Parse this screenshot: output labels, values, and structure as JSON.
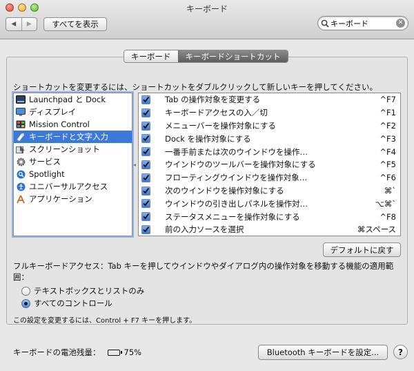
{
  "window": {
    "title": "キーボード"
  },
  "toolbar": {
    "back_glyph": "◀",
    "forward_glyph": "▶",
    "show_all_label": "すべてを表示",
    "search_value": "キーボード"
  },
  "tabs": [
    {
      "label": "キーボード",
      "active": false
    },
    {
      "label": "キーボードショートカット",
      "active": true
    }
  ],
  "instruction": "ショートカットを変更するには、ショートカットをダブルクリックして新しいキーを押してください。",
  "categories": [
    {
      "label": "Launchpad と Dock",
      "icon": "launchpad-dock-icon"
    },
    {
      "label": "ディスプレイ",
      "icon": "display-icon"
    },
    {
      "label": "Mission Control",
      "icon": "mission-control-icon"
    },
    {
      "label": "キーボードと文字入力",
      "icon": "keyboard-input-icon",
      "selected": true
    },
    {
      "label": "スクリーンショット",
      "icon": "screenshot-icon"
    },
    {
      "label": "サービス",
      "icon": "services-gear-icon"
    },
    {
      "label": "Spotlight",
      "icon": "spotlight-icon"
    },
    {
      "label": "ユニバーサルアクセス",
      "icon": "universal-access-icon"
    },
    {
      "label": "アプリケーション",
      "icon": "applications-icon"
    }
  ],
  "shortcuts": [
    {
      "name": "Tab の操作対象を変更する",
      "key": "^F7",
      "checked": true
    },
    {
      "name": "キーボードアクセスの入／切",
      "key": "^F1",
      "checked": true
    },
    {
      "name": "メニューバーを操作対象にする",
      "key": "^F2",
      "checked": true
    },
    {
      "name": "Dock を操作対象にする",
      "key": "^F3",
      "checked": true
    },
    {
      "name": "一番手前または次のウインドウを操作…",
      "key": "^F4",
      "checked": true
    },
    {
      "name": "ウインドウのツールバーを操作対象にする",
      "key": "^F5",
      "checked": true
    },
    {
      "name": "フローティングウインドウを操作対象…",
      "key": "^F6",
      "checked": true
    },
    {
      "name": "次のウインドウを操作対象にする",
      "key": "⌘`",
      "checked": true
    },
    {
      "name": "ウインドウの引き出しパネルを操作対…",
      "key": "⌥⌘`",
      "checked": true
    },
    {
      "name": "ステータスメニューを操作対象にする",
      "key": "^F8",
      "checked": true
    },
    {
      "name": "前の入力ソースを選択",
      "key": "⌘スペース",
      "checked": true
    }
  ],
  "default_button_label": "デフォルトに戻す",
  "full_keyboard_access": {
    "description": "フルキーボードアクセス：Tab キーを押してウインドウやダイアログ内の操作対象を移動する機能の適用範囲：",
    "options": [
      {
        "label": "テキストボックスとリストのみ",
        "selected": false
      },
      {
        "label": "すべてのコントロール",
        "selected": true
      }
    ],
    "note": "この設定を変更するには、Control + F7 キーを押します。"
  },
  "battery": {
    "label": "キーボードの電池残量：",
    "percent_text": "75%",
    "level": 0.75
  },
  "bluetooth_button_label": "Bluetooth キーボードを設定...",
  "help_label": "?"
}
